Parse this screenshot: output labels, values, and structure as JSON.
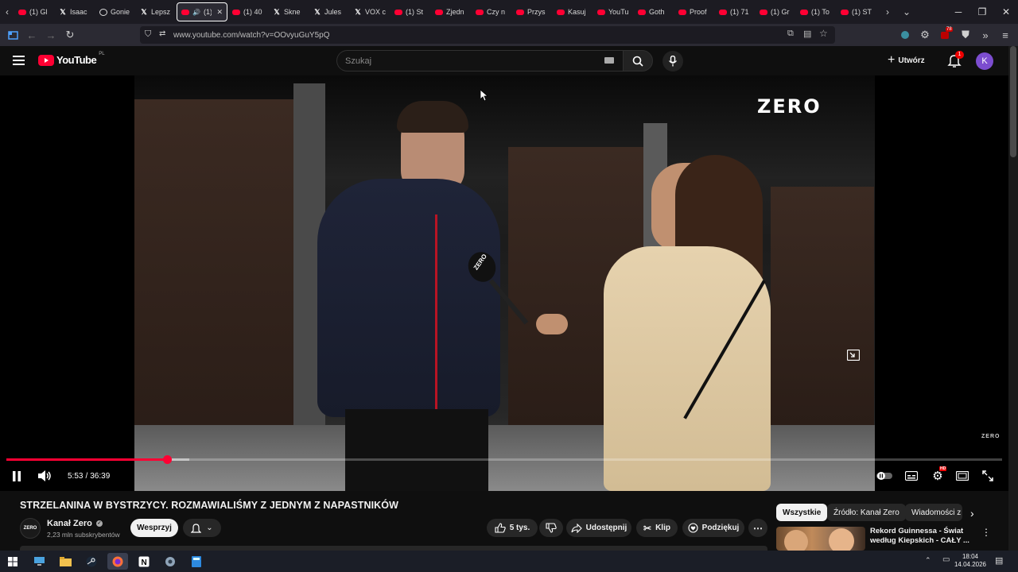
{
  "browser": {
    "tabs": [
      {
        "label": "(1) Gl",
        "favicon": "youtube"
      },
      {
        "label": "Isaac",
        "favicon": "x"
      },
      {
        "label": "Gonie",
        "favicon": "x-circle"
      },
      {
        "label": "Lepsz",
        "favicon": "x"
      },
      {
        "label": "(1)",
        "favicon": "youtube",
        "active": true
      },
      {
        "label": "(1) 40",
        "favicon": "youtube"
      },
      {
        "label": "Skne",
        "favicon": "x"
      },
      {
        "label": "Jules",
        "favicon": "x"
      },
      {
        "label": "VOX c",
        "favicon": "x"
      },
      {
        "label": "(1) St",
        "favicon": "youtube"
      },
      {
        "label": "Zjedn",
        "favicon": "youtube"
      },
      {
        "label": "Czy n",
        "favicon": "youtube"
      },
      {
        "label": "Przys",
        "favicon": "youtube"
      },
      {
        "label": "Kasuj",
        "favicon": "youtube"
      },
      {
        "label": "YouTu",
        "favicon": "youtube"
      },
      {
        "label": "Goth",
        "favicon": "youtube"
      },
      {
        "label": "Proof",
        "favicon": "youtube"
      },
      {
        "label": "(1) 71",
        "favicon": "youtube"
      },
      {
        "label": "(1) Gr",
        "favicon": "youtube"
      },
      {
        "label": "(1) To",
        "favicon": "youtube"
      },
      {
        "label": "(1) ST",
        "favicon": "youtube"
      }
    ],
    "url": "www.youtube.com/watch?v=OOvyuGuY5pQ",
    "extension_badge": "78"
  },
  "youtube": {
    "logo_text": "YouTube",
    "region_code": "PL",
    "search_placeholder": "Szukaj",
    "create_label": "Utwórz",
    "notification_count": "1",
    "avatar_letter": "K"
  },
  "player": {
    "watermark": "ZERO",
    "watermark_small": "ZERO",
    "mic_logo": "ZERO",
    "current_time": "5:53",
    "time_separator": "/",
    "duration": "36:39",
    "progress_fraction": 0.161,
    "buffer_fraction": 0.184,
    "settings_badge": "HD"
  },
  "video": {
    "title": "STRZELANINA W BYSTRZYCY. ROZMAWIALIŚMY Z JEDNYM Z NAPASTNIKÓW",
    "channel_logo_text": "ZERO",
    "channel_name": "Kanał Zero",
    "subscribers": "2,23 mln subskrybentów",
    "support_label": "Wesprzyj",
    "likes": "5 tys.",
    "share_label": "Udostępnij",
    "clip_label": "Klip",
    "thanks_label": "Podziękuj"
  },
  "sidebar": {
    "chips": [
      "Wszystkie",
      "Źródło: Kanał Zero",
      "Wiadomości z"
    ],
    "recommendation_title": "Rekord Guinnessa - Świat według Kiepskich - CAŁY ..."
  },
  "taskbar": {
    "time": "18:04",
    "date": "14.04.2026"
  },
  "colors": {
    "accent_red": "#ff0033",
    "bg": "#0f0f0f",
    "avatar": "#7c4dcf"
  }
}
